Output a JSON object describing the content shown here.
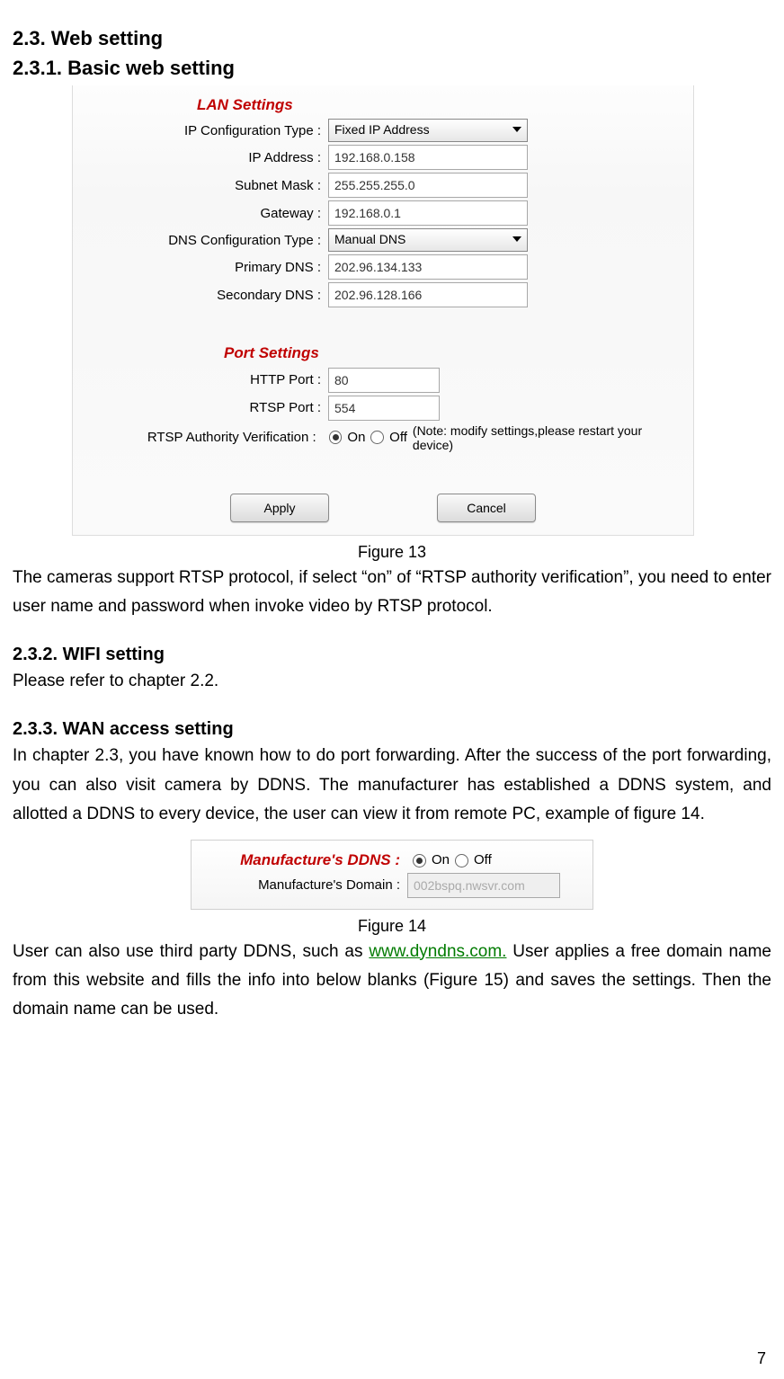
{
  "headings": {
    "h2_3": "2.3. Web setting",
    "h2_3_1": "2.3.1.  Basic web setting",
    "h2_3_2": "2.3.2.  WIFI setting",
    "h2_3_3": "2.3.3.  WAN access setting"
  },
  "figure13": {
    "lan_header": "LAN Settings",
    "labels": {
      "ip_conf_type": "IP Configuration Type :",
      "ip_address": "IP Address :",
      "subnet_mask": "Subnet Mask :",
      "gateway": "Gateway :",
      "dns_conf_type": "DNS Configuration Type :",
      "primary_dns": "Primary DNS :",
      "secondary_dns": "Secondary DNS :",
      "port_header": "Port Settings",
      "http_port": "HTTP Port :",
      "rtsp_port": "RTSP Port :",
      "rtsp_auth": "RTSP Authority Verification :"
    },
    "values": {
      "ip_conf_type": "Fixed IP Address",
      "ip_address": "192.168.0.158",
      "subnet_mask": "255.255.255.0",
      "gateway": "192.168.0.1",
      "dns_conf_type": "Manual DNS",
      "primary_dns": "202.96.134.133",
      "secondary_dns": "202.96.128.166",
      "http_port": "80",
      "rtsp_port": "554"
    },
    "radio": {
      "on": "On",
      "off": "Off",
      "selected": "on"
    },
    "note": "(Note: modify settings,please restart your device)",
    "buttons": {
      "apply": "Apply",
      "cancel": "Cancel"
    },
    "caption": "Figure 13"
  },
  "paragraphs": {
    "after_fig13": "The cameras support RTSP protocol, if select “on” of “RTSP authority verification”, you need to enter user name and password when invoke video by RTSP protocol.",
    "wifi": "Please refer to chapter 2.2.",
    "wan": "In chapter 2.3, you have known how to do port forwarding. After the success of the port forwarding, you can also visit camera by DDNS. The manufacturer has established a DDNS system, and allotted a DDNS to every device, the user can view it from remote PC, example of figure 14.",
    "after_fig14_a": "User can also use third party DDNS, such as ",
    "after_fig14_link": "www.dyndns.com.",
    "after_fig14_b": " User applies a free domain name from this website and fills the info into below blanks (Figure 15) and saves the settings. Then the domain name can be used."
  },
  "figure14": {
    "labels": {
      "mfg_ddns": "Manufacture's DDNS :",
      "mfg_domain": "Manufacture's Domain :"
    },
    "radio": {
      "on": "On",
      "off": "Off",
      "selected": "on"
    },
    "values": {
      "domain": "002bspq.nwsvr.com"
    },
    "caption": "Figure 14"
  },
  "page_number": "7"
}
